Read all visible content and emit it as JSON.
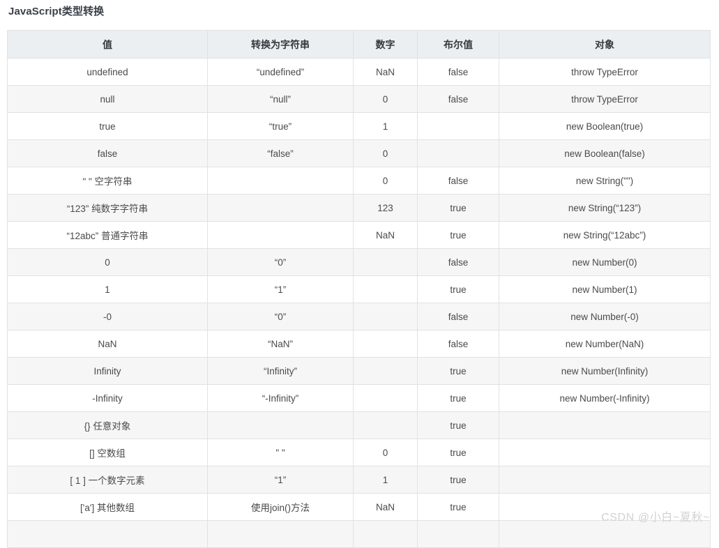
{
  "page": {
    "title": "JavaScript类型转换",
    "watermark": "CSDN @小白~夏秋~"
  },
  "table": {
    "headers": [
      "值",
      "转换为字符串",
      "数字",
      "布尔值",
      "对象"
    ],
    "rows": [
      {
        "value": "undefined",
        "to_string": "“undefined”",
        "to_number": "NaN",
        "to_boolean": "false",
        "to_object": "throw TypeError"
      },
      {
        "value": "null",
        "to_string": "“null”",
        "to_number": "0",
        "to_boolean": "false",
        "to_object": "throw TypeError"
      },
      {
        "value": "true",
        "to_string": "“true”",
        "to_number": "1",
        "to_boolean": "",
        "to_object": "new Boolean(true)"
      },
      {
        "value": "false",
        "to_string": "“false”",
        "to_number": "0",
        "to_boolean": "",
        "to_object": "new Boolean(false)"
      },
      {
        "value": "\" \" 空字符串",
        "to_string": "",
        "to_number": "0",
        "to_boolean": "false",
        "to_object": "new String(\"\")"
      },
      {
        "value": "“123” 纯数字字符串",
        "to_string": "",
        "to_number": "123",
        "to_boolean": "true",
        "to_object": "new String(“123”)"
      },
      {
        "value": "“12abc” 普通字符串",
        "to_string": "",
        "to_number": "NaN",
        "to_boolean": "true",
        "to_object": "new String(“12abc”)"
      },
      {
        "value": "0",
        "to_string": "“0”",
        "to_number": "",
        "to_boolean": "false",
        "to_object": "new Number(0)"
      },
      {
        "value": "1",
        "to_string": "“1”",
        "to_number": "",
        "to_boolean": "true",
        "to_object": "new Number(1)"
      },
      {
        "value": "-0",
        "to_string": "“0”",
        "to_number": "",
        "to_boolean": "false",
        "to_object": "new Number(-0)"
      },
      {
        "value": "NaN",
        "to_string": "“NaN”",
        "to_number": "",
        "to_boolean": "false",
        "to_object": "new Number(NaN)"
      },
      {
        "value": "Infinity",
        "to_string": "“Infinity”",
        "to_number": "",
        "to_boolean": "true",
        "to_object": "new Number(Infinity)"
      },
      {
        "value": "-Infinity",
        "to_string": "“-Infinity”",
        "to_number": "",
        "to_boolean": "true",
        "to_object": "new Number(-Infinity)"
      },
      {
        "value": "{} 任意对象",
        "to_string": "",
        "to_number": "",
        "to_boolean": "true",
        "to_object": ""
      },
      {
        "value": "[] 空数组",
        "to_string": "\" \"",
        "to_number": "0",
        "to_boolean": "true",
        "to_object": ""
      },
      {
        "value": "[ 1 ] 一个数字元素",
        "to_string": "“1”",
        "to_number": "1",
        "to_boolean": "true",
        "to_object": ""
      },
      {
        "value": "['a'] 其他数组",
        "to_string": "使用join()方法",
        "to_number": "NaN",
        "to_boolean": "true",
        "to_object": ""
      },
      {
        "value": "",
        "to_string": "",
        "to_number": "",
        "to_boolean": "",
        "to_object": ""
      }
    ]
  },
  "colors": {
    "header_bg": "#eceff1",
    "stripe_bg": "#f6f6f6",
    "border": "#dfe2e5",
    "text": "#4a4a4a",
    "title": "#3b4049",
    "watermark": "#d2d2d2"
  }
}
